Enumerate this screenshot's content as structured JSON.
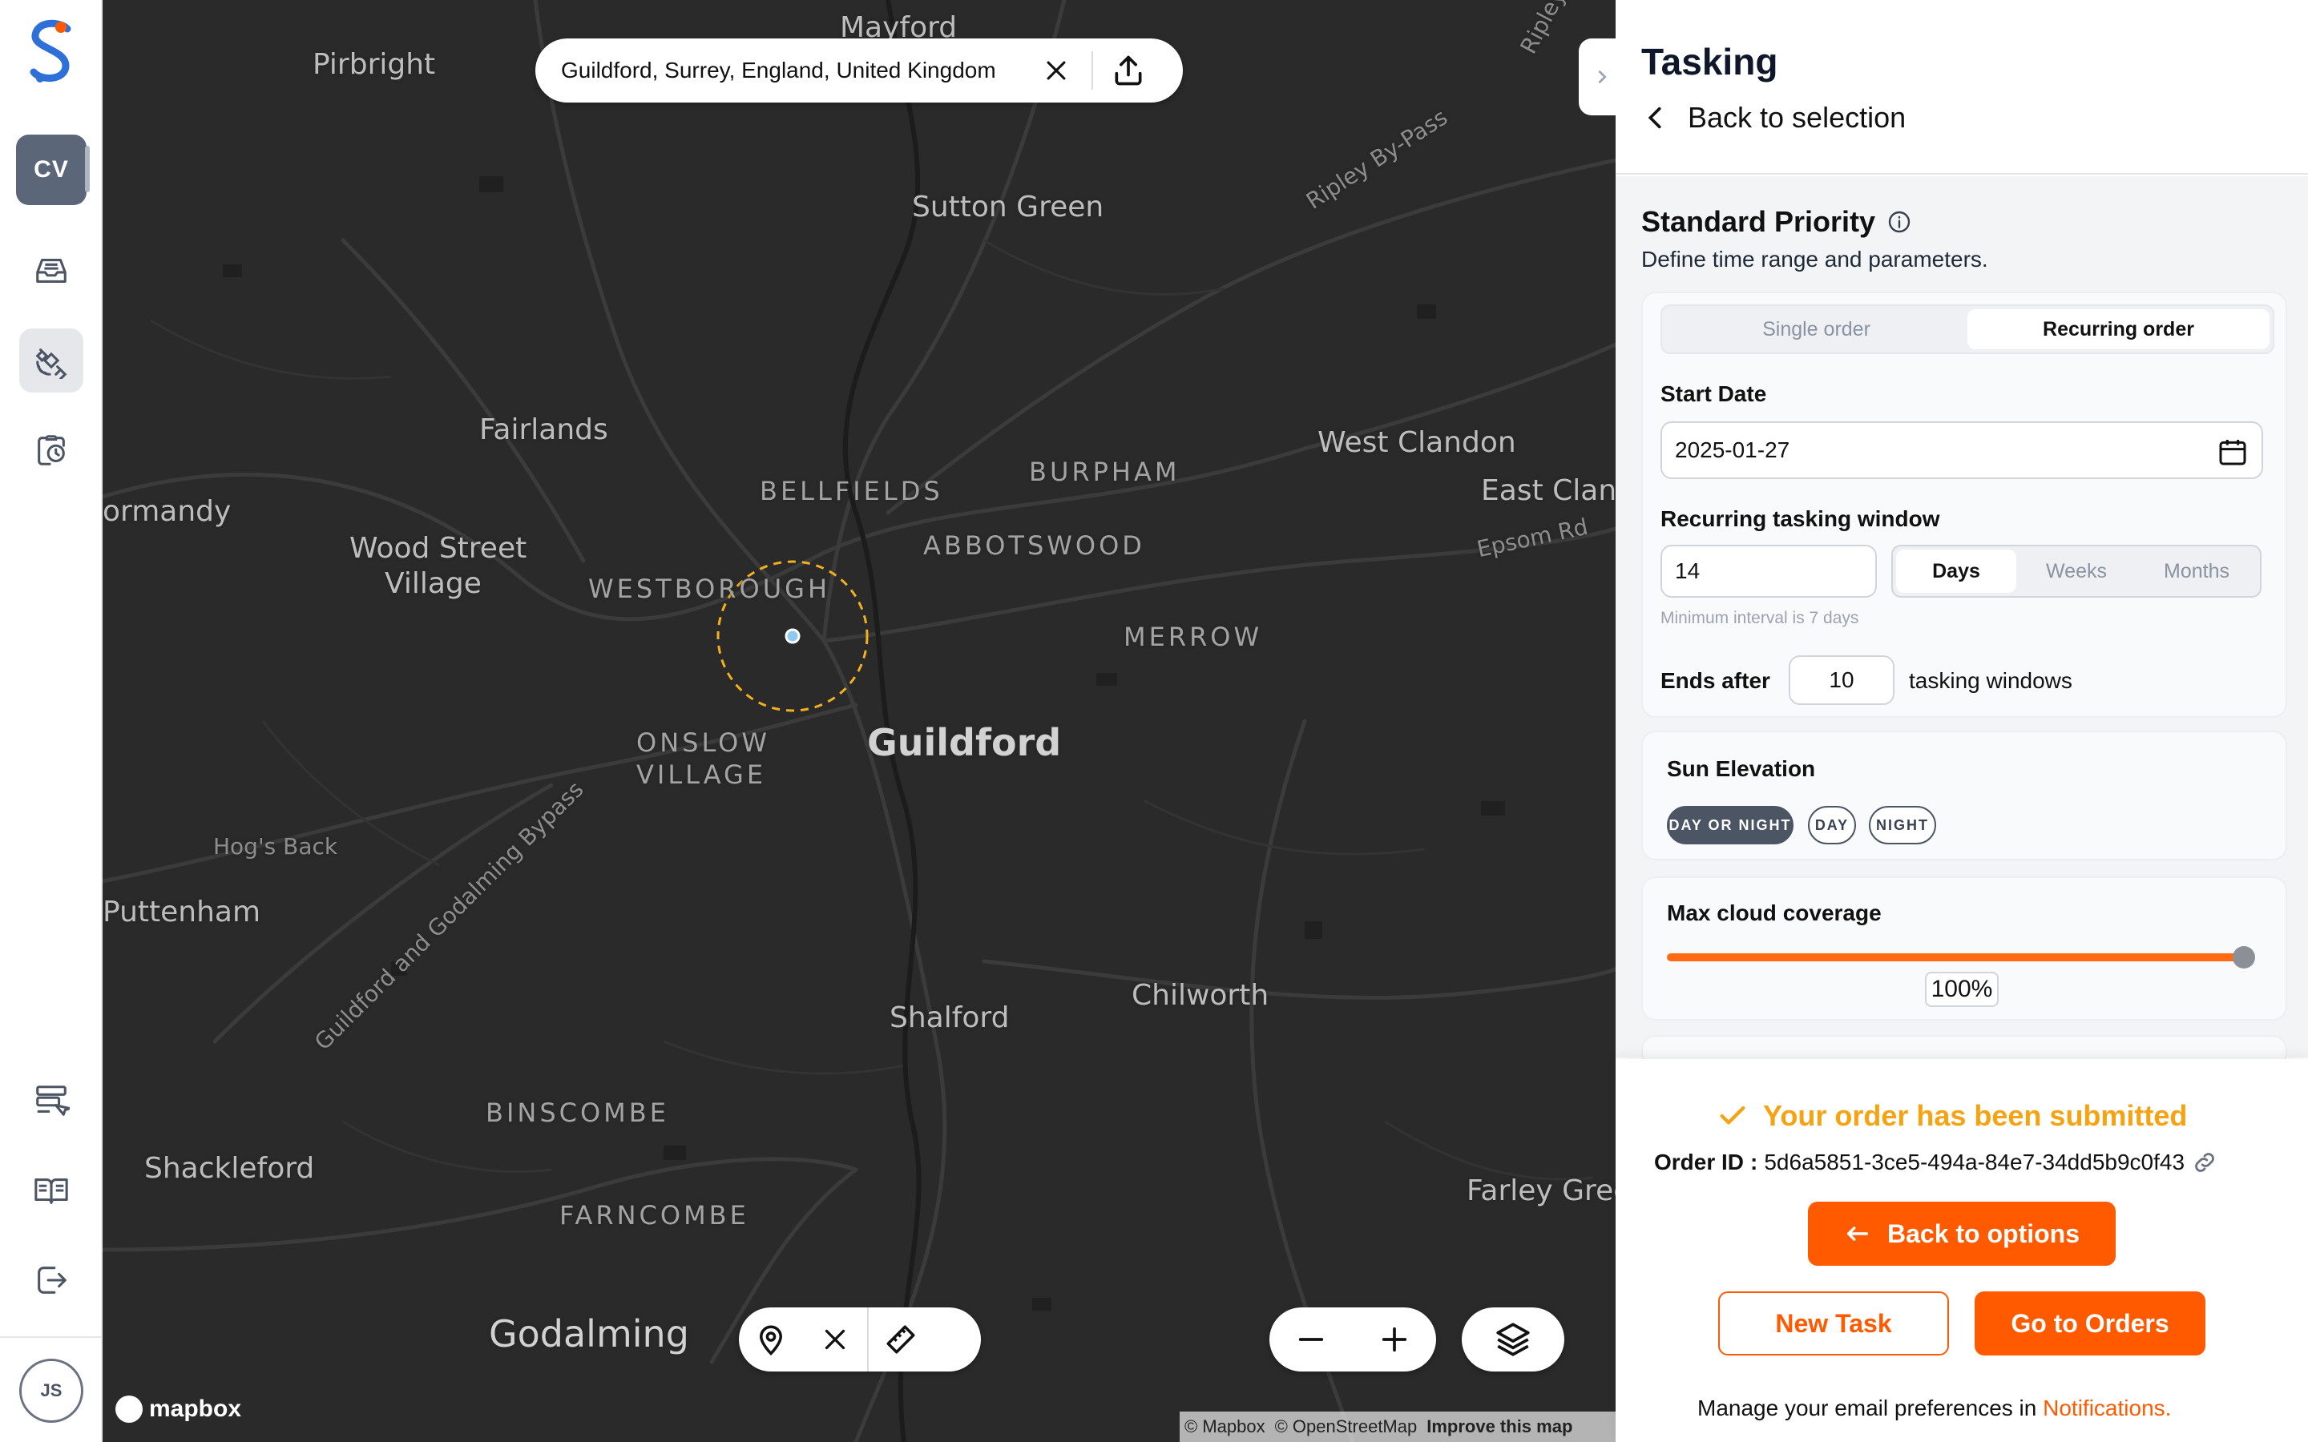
{
  "rail": {
    "workspace_initials": "CV",
    "user_initials": "JS",
    "icons": [
      "inbox-icon",
      "satellite-icon",
      "clipboard-clock-icon",
      "list-cursor-icon",
      "book-open-icon",
      "logout-icon"
    ]
  },
  "map": {
    "search_query": "Guildford, Surrey, England, United Kingdom",
    "labels": {
      "mayford": "Mayford",
      "pirbright": "Pirbright",
      "ripley": "Ripley",
      "sutton_green": "Sutton Green",
      "ripley_bypass": "Ripley By-Pass",
      "fairlands": "Fairlands",
      "normandy": "ormandy",
      "bellfields": "BELLFIELDS",
      "burpham": "BURPHAM",
      "west_clandon": "West Clandon",
      "east_clandon": "East Cland",
      "epsom_rd": "Epsom Rd",
      "wood_street_1": "Wood Street",
      "wood_street_2": "Village",
      "westborough": "WESTBOROUGH",
      "abbotswood": "ABBOTSWOOD",
      "merrow": "MERROW",
      "onslow_1": "ONSLOW",
      "onslow_2": "VILLAGE",
      "guildford": "Guildford",
      "hogs_back": "Hog's Back",
      "bypass": "Guildford and Godalming Bypass",
      "puttenham": "Puttenham",
      "shalford": "Shalford",
      "chilworth": "Chilworth",
      "binscombe": "BINSCOMBE",
      "shackleford": "Shackleford",
      "farley_green": "Farley Gree",
      "farncombe": "FARNCOMBE",
      "godalming": "Godalming"
    },
    "brand": "mapbox",
    "attribution": {
      "mapbox": "© Mapbox",
      "osm": "© OpenStreetMap",
      "improve": "Improve this map"
    }
  },
  "panel": {
    "title": "Tasking",
    "back_label": "Back to selection",
    "section_title": "Standard Priority",
    "section_subtitle": "Define time range and parameters.",
    "order_type": {
      "single": "Single order",
      "recurring": "Recurring order",
      "selected": "Recurring order"
    },
    "start_date_label": "Start Date",
    "start_date_value": "2025-01-27",
    "window_label": "Recurring tasking window",
    "window_value": "14",
    "window_units": {
      "days": "Days",
      "weeks": "Weeks",
      "months": "Months",
      "selected": "Days"
    },
    "window_hint": "Minimum interval is 7 days",
    "ends_after_label": "Ends after",
    "ends_after_value": "10",
    "ends_after_suffix": "tasking windows",
    "sun_elevation_label": "Sun Elevation",
    "sun_options": {
      "day_or_night": "DAY OR NIGHT",
      "day": "DAY",
      "night": "NIGHT",
      "selected": "DAY OR NIGHT"
    },
    "cloud_label": "Max cloud coverage",
    "cloud_value": "100%",
    "cloud_fraction": 1.0
  },
  "footer": {
    "submitted": "Your order has been submitted",
    "order_id_label": "Order ID",
    "order_id_value": "5d6a5851-3ce5-494a-84e7-34dd5b9c0f43",
    "back_to_options": "Back to options",
    "new_task": "New Task",
    "go_to_orders": "Go to Orders",
    "manage_text": "Manage your email preferences in",
    "notifications_link": "Notifications."
  },
  "colors": {
    "accent": "#ff5a00",
    "success": "#f6a313",
    "map_bg": "#2a2a2b"
  }
}
